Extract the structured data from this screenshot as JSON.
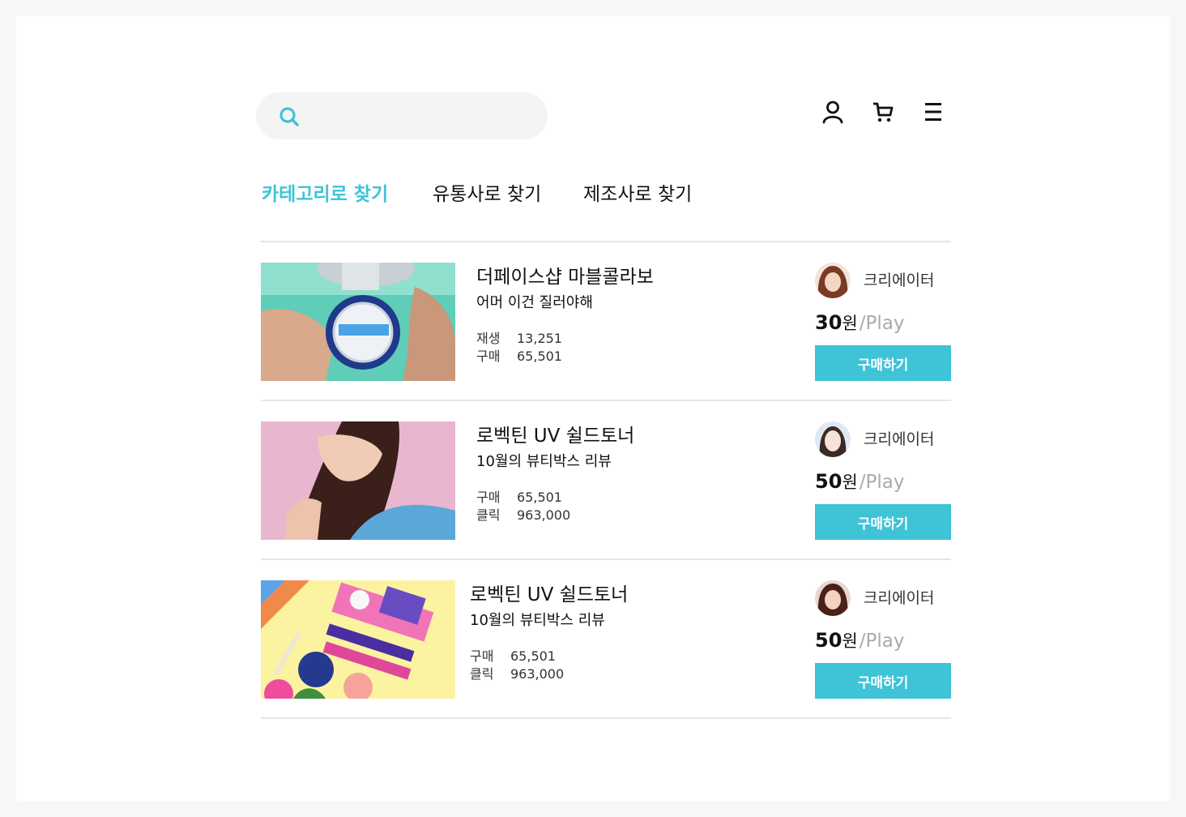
{
  "colors": {
    "accent": "#3fc3d7",
    "divider": "#e6e6e6",
    "price_per": "#aaaaaa",
    "search_bg": "#f4f4f4"
  },
  "header": {
    "search": {
      "placeholder": "",
      "value": "",
      "icon": "search-icon"
    },
    "icons": [
      "user-icon",
      "cart-icon",
      "menu-icon"
    ]
  },
  "tabs": [
    {
      "label": "카테고리로 찾기",
      "active": true
    },
    {
      "label": "유통사로 찾기",
      "active": false
    },
    {
      "label": "제조사로 찾기",
      "active": false
    }
  ],
  "items": [
    {
      "title": "더페이스샵 마블콜라보",
      "subtitle": "어머 이건 질러야해",
      "stats": [
        {
          "label": "재생",
          "value": "13,251"
        },
        {
          "label": "구매",
          "value": "65,501"
        }
      ],
      "creator": "크리에이터",
      "price": "30",
      "price_unit": "원",
      "price_per": "/Play",
      "buy_label": "구매하기"
    },
    {
      "title": "로벡틴 UV 쉴드토너",
      "subtitle": "10월의 뷰티박스 리뷰",
      "stats": [
        {
          "label": "구매",
          "value": "65,501"
        },
        {
          "label": "클릭",
          "value": "963,000"
        }
      ],
      "creator": "크리에이터",
      "price": "50",
      "price_unit": "원",
      "price_per": "/Play",
      "buy_label": "구매하기"
    },
    {
      "title": "로벡틴 UV 쉴드토너",
      "subtitle": "10월의 뷰티박스 리뷰",
      "stats": [
        {
          "label": "구매",
          "value": "65,501"
        },
        {
          "label": "클릭",
          "value": "963,000"
        }
      ],
      "creator": "크리에이터",
      "price": "50",
      "price_unit": "원",
      "price_per": "/Play",
      "buy_label": "구매하기"
    }
  ]
}
